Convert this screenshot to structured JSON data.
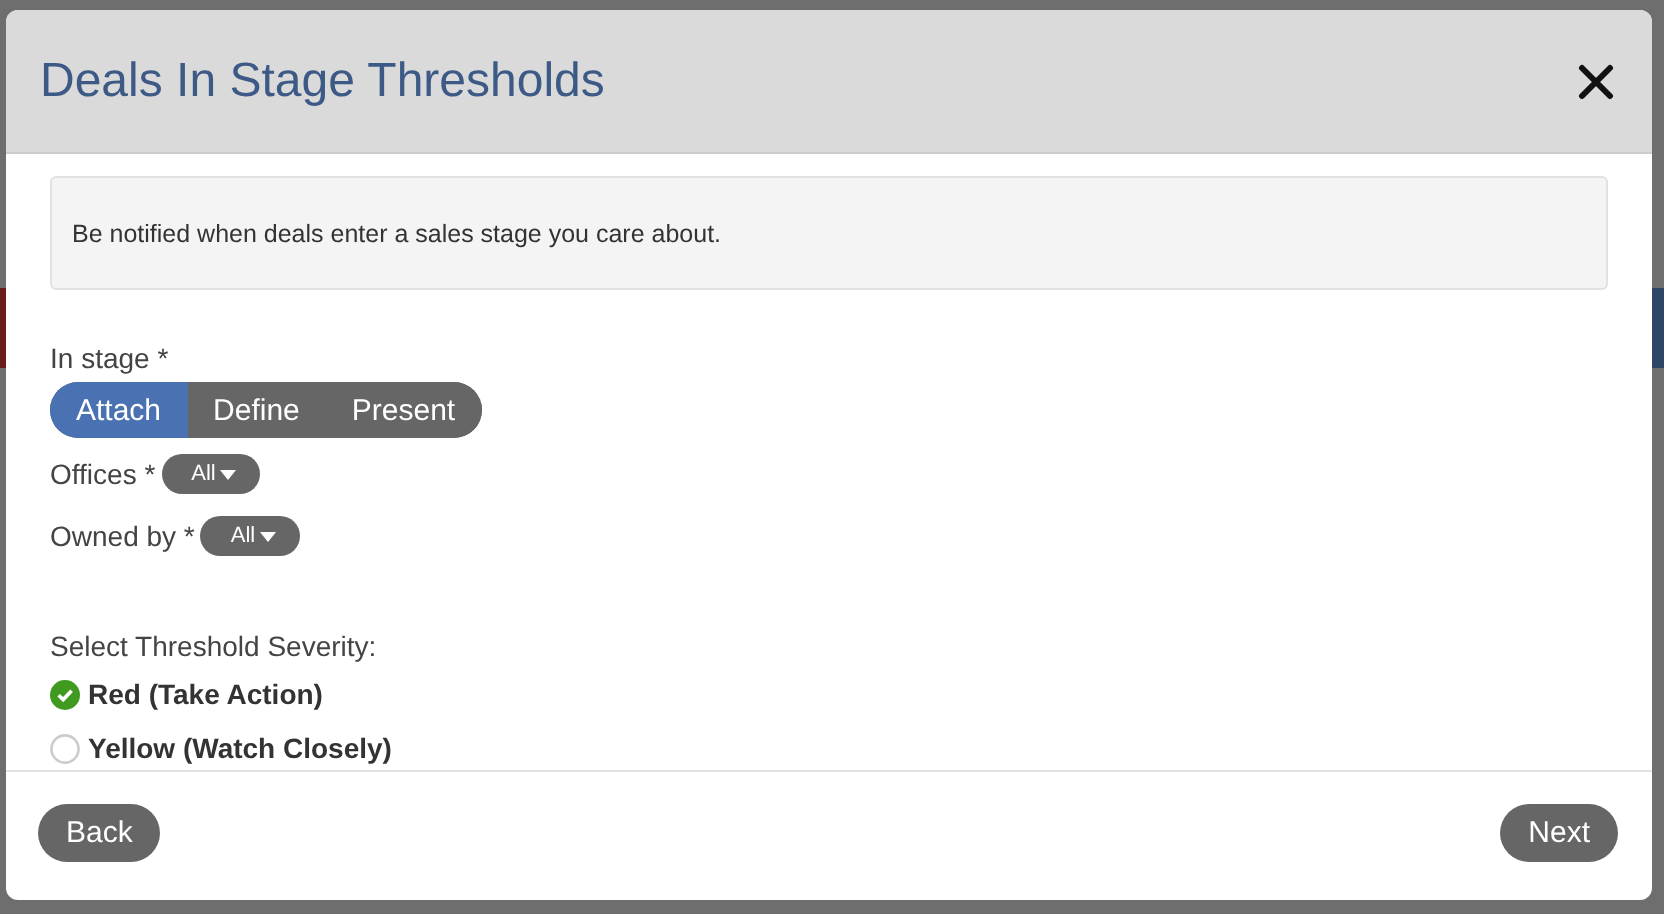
{
  "dialog": {
    "title": "Deals In Stage Thresholds"
  },
  "info": "Be notified when deals enter a sales stage you care about.",
  "stage": {
    "label": "In stage *",
    "options": [
      {
        "label": "Attach",
        "selected": true
      },
      {
        "label": "Define",
        "selected": false
      },
      {
        "label": "Present",
        "selected": false
      }
    ]
  },
  "filters": [
    {
      "label": "Offices *",
      "value": "All"
    },
    {
      "label": "Owned by *",
      "value": "All"
    }
  ],
  "severity": {
    "label": "Select Threshold Severity:",
    "options": [
      {
        "label": "Red (Take Action)",
        "selected": true
      },
      {
        "label": "Yellow (Watch Closely)",
        "selected": false
      }
    ]
  },
  "buttons": [
    {
      "label": "Back",
      "kind": "back"
    },
    {
      "label": "Next",
      "kind": "next"
    }
  ]
}
